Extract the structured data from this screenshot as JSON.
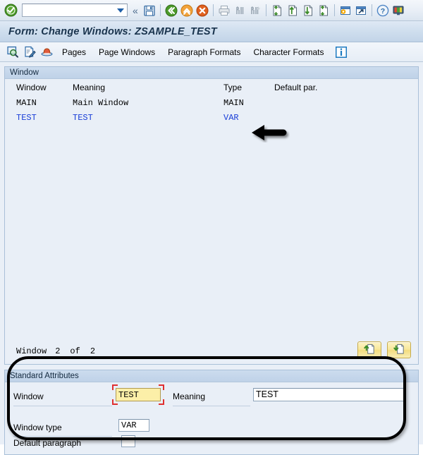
{
  "system_toolbar": {
    "ok_icon": "green-check-icon",
    "command_field": {
      "value": "",
      "placeholder": ""
    },
    "back_chevron": "«",
    "icons": [
      {
        "name": "save-icon",
        "label": "Save"
      },
      {
        "name": "back-icon",
        "label": "Back"
      },
      {
        "name": "exit-icon",
        "label": "Exit"
      },
      {
        "name": "cancel-icon",
        "label": "Cancel"
      },
      {
        "name": "print-icon",
        "label": "Print"
      },
      {
        "name": "find-icon",
        "label": "Find"
      },
      {
        "name": "find-next-icon",
        "label": "Find Next"
      },
      {
        "name": "first-page-icon",
        "label": "First Page"
      },
      {
        "name": "previous-page-icon",
        "label": "Previous Page"
      },
      {
        "name": "next-page-icon",
        "label": "Next Page"
      },
      {
        "name": "last-page-icon",
        "label": "Last Page"
      },
      {
        "name": "customize-local-layout-icon",
        "label": "Customize Local Layout"
      },
      {
        "name": "create-shortcut-icon",
        "label": "Create Shortcut"
      },
      {
        "name": "help-icon",
        "label": "Help"
      },
      {
        "name": "local-layout-icon",
        "label": "Local Layout"
      }
    ]
  },
  "title_bar": {
    "title": "Form: Change Windows: ZSAMPLE_TEST"
  },
  "app_toolbar": {
    "icons": [
      {
        "name": "display-icon",
        "label": "Display"
      },
      {
        "name": "change-icon",
        "label": "Change"
      },
      {
        "name": "print-preview-icon",
        "label": "Print Preview"
      }
    ],
    "buttons": [
      {
        "name": "pages-button",
        "label": "Pages"
      },
      {
        "name": "page-windows-button",
        "label": "Page Windows"
      },
      {
        "name": "paragraph-formats-button",
        "label": "Paragraph Formats"
      },
      {
        "name": "character-formats-button",
        "label": "Character Formats"
      }
    ],
    "info_icon": "information-icon"
  },
  "window_group": {
    "header": "Window",
    "columns": [
      "Window",
      "Meaning",
      "Type",
      "Default par."
    ],
    "rows": [
      {
        "window": "MAIN",
        "meaning": "Main Window",
        "type": "MAIN",
        "default_par": "",
        "selected": false
      },
      {
        "window": "TEST",
        "meaning": "TEST",
        "type": "VAR",
        "default_par": "",
        "selected": true
      }
    ],
    "paging": {
      "label": "Window",
      "current": "2",
      "of": "of",
      "total": "2"
    },
    "nav_buttons": [
      {
        "name": "scroll-up-button",
        "label": "Previous Window"
      },
      {
        "name": "scroll-down-button",
        "label": "Next Window"
      }
    ]
  },
  "attributes_panel": {
    "header": "Standard Attributes",
    "fields": {
      "window_label": "Window",
      "window_value": "TEST",
      "meaning_label": "Meaning",
      "meaning_value": "TEST",
      "window_type_label": "Window type",
      "window_type_value": "VAR",
      "default_paragraph_label": "Default paragraph",
      "default_paragraph_value": ""
    }
  },
  "annotations": {
    "arrow": "left-arrow-annotation",
    "highlight_rect": "standard-attributes-highlight"
  },
  "colors": {
    "focus_yellow": "#FCEFA8",
    "focus_red": "#E03030",
    "link_blue": "#1A3FD8",
    "panel_bg": "#E9EFF7",
    "title_text": "#19334D"
  }
}
